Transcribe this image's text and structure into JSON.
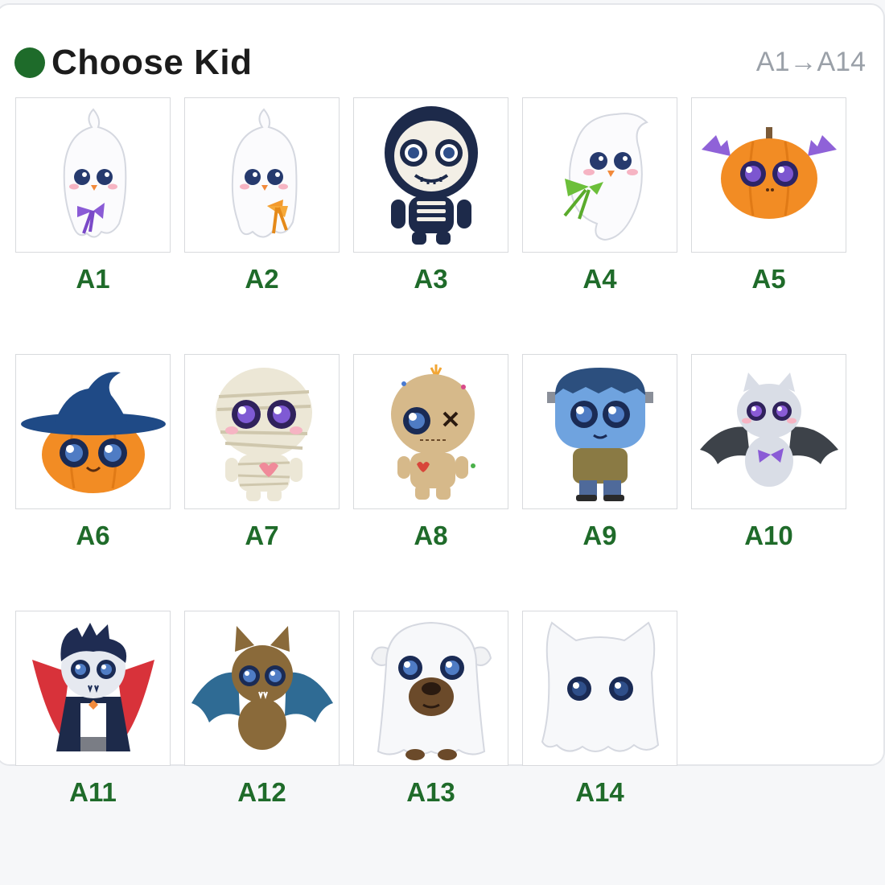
{
  "header": {
    "title": "Choose Kid",
    "range": "A1→A14",
    "dot_color": "#1e6b2a"
  },
  "kids": [
    {
      "label": "A1",
      "icon": "ghost-purple-bow-icon"
    },
    {
      "label": "A2",
      "icon": "ghost-orange-bow-icon"
    },
    {
      "label": "A3",
      "icon": "skeleton-icon"
    },
    {
      "label": "A4",
      "icon": "ghost-green-bow-icon"
    },
    {
      "label": "A5",
      "icon": "pumpkin-bat-icon"
    },
    {
      "label": "A6",
      "icon": "pumpkin-witch-hat-icon"
    },
    {
      "label": "A7",
      "icon": "mummy-icon"
    },
    {
      "label": "A8",
      "icon": "voodoo-doll-icon"
    },
    {
      "label": "A9",
      "icon": "frankenstein-icon"
    },
    {
      "label": "A10",
      "icon": "gray-bat-icon"
    },
    {
      "label": "A11",
      "icon": "vampire-icon"
    },
    {
      "label": "A12",
      "icon": "brown-bat-icon"
    },
    {
      "label": "A13",
      "icon": "dog-ghost-icon"
    },
    {
      "label": "A14",
      "icon": "cat-ghost-icon"
    }
  ],
  "colors": {
    "label": "#1f6b2a",
    "range": "#9aa0a8"
  }
}
